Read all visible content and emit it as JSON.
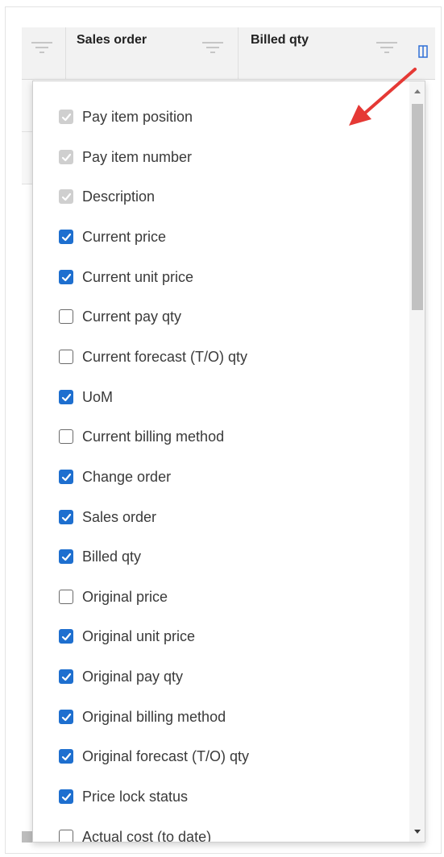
{
  "grid": {
    "columns": [
      {
        "title": ""
      },
      {
        "title": "Sales order"
      },
      {
        "title": "Billed qty"
      }
    ]
  },
  "columns_menu": {
    "items": [
      {
        "label": "Pay item position",
        "state": "disabled"
      },
      {
        "label": "Pay item number",
        "state": "disabled"
      },
      {
        "label": "Description",
        "state": "disabled"
      },
      {
        "label": "Current price",
        "state": "checked"
      },
      {
        "label": "Current unit price",
        "state": "checked"
      },
      {
        "label": "Current pay qty",
        "state": "unchecked"
      },
      {
        "label": "Current forecast (T/O) qty",
        "state": "unchecked"
      },
      {
        "label": "UoM",
        "state": "checked"
      },
      {
        "label": "Current billing method",
        "state": "unchecked"
      },
      {
        "label": "Change order",
        "state": "checked"
      },
      {
        "label": "Sales order",
        "state": "checked"
      },
      {
        "label": "Billed qty",
        "state": "checked"
      },
      {
        "label": "Original price",
        "state": "unchecked"
      },
      {
        "label": "Original unit price",
        "state": "checked"
      },
      {
        "label": "Original pay qty",
        "state": "checked"
      },
      {
        "label": "Original billing method",
        "state": "checked"
      },
      {
        "label": "Original forecast (T/O) qty",
        "state": "checked"
      },
      {
        "label": "Price lock status",
        "state": "checked"
      },
      {
        "label": "Actual cost (to date)",
        "state": "unchecked"
      }
    ]
  },
  "colors": {
    "checkbox_checked": "#1e6fcf",
    "checkbox_disabled": "#cfcfcf",
    "annotation_arrow": "#e53935",
    "column_picker_icon": "#2f6fd6"
  },
  "icons": {
    "filter": "filter-icon",
    "column_picker": "column-chooser-icon",
    "checkmark": "checkmark-icon",
    "scroll_up": "triangle-up-icon",
    "scroll_down": "triangle-down-icon",
    "annotation": "arrow-icon"
  }
}
